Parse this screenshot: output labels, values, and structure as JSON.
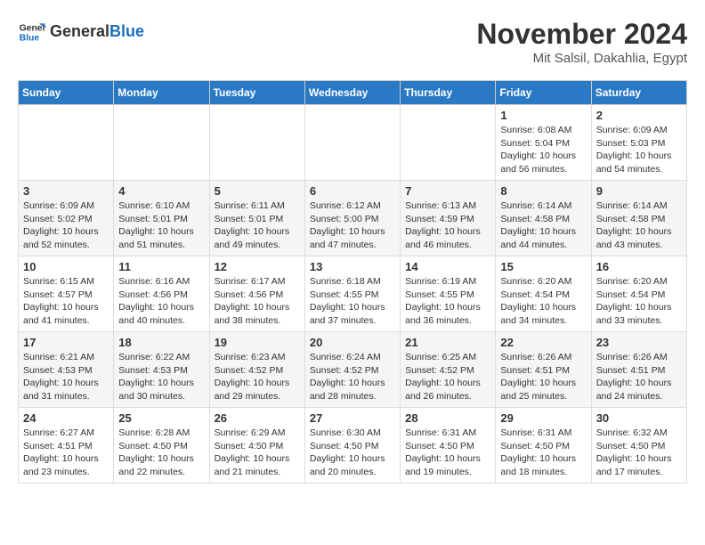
{
  "header": {
    "logo_general": "General",
    "logo_blue": "Blue",
    "month_title": "November 2024",
    "location": "Mit Salsil, Dakahlia, Egypt"
  },
  "weekdays": [
    "Sunday",
    "Monday",
    "Tuesday",
    "Wednesday",
    "Thursday",
    "Friday",
    "Saturday"
  ],
  "weeks": [
    [
      {
        "day": "",
        "info": ""
      },
      {
        "day": "",
        "info": ""
      },
      {
        "day": "",
        "info": ""
      },
      {
        "day": "",
        "info": ""
      },
      {
        "day": "",
        "info": ""
      },
      {
        "day": "1",
        "info": "Sunrise: 6:08 AM\nSunset: 5:04 PM\nDaylight: 10 hours\nand 56 minutes."
      },
      {
        "day": "2",
        "info": "Sunrise: 6:09 AM\nSunset: 5:03 PM\nDaylight: 10 hours\nand 54 minutes."
      }
    ],
    [
      {
        "day": "3",
        "info": "Sunrise: 6:09 AM\nSunset: 5:02 PM\nDaylight: 10 hours\nand 52 minutes."
      },
      {
        "day": "4",
        "info": "Sunrise: 6:10 AM\nSunset: 5:01 PM\nDaylight: 10 hours\nand 51 minutes."
      },
      {
        "day": "5",
        "info": "Sunrise: 6:11 AM\nSunset: 5:01 PM\nDaylight: 10 hours\nand 49 minutes."
      },
      {
        "day": "6",
        "info": "Sunrise: 6:12 AM\nSunset: 5:00 PM\nDaylight: 10 hours\nand 47 minutes."
      },
      {
        "day": "7",
        "info": "Sunrise: 6:13 AM\nSunset: 4:59 PM\nDaylight: 10 hours\nand 46 minutes."
      },
      {
        "day": "8",
        "info": "Sunrise: 6:14 AM\nSunset: 4:58 PM\nDaylight: 10 hours\nand 44 minutes."
      },
      {
        "day": "9",
        "info": "Sunrise: 6:14 AM\nSunset: 4:58 PM\nDaylight: 10 hours\nand 43 minutes."
      }
    ],
    [
      {
        "day": "10",
        "info": "Sunrise: 6:15 AM\nSunset: 4:57 PM\nDaylight: 10 hours\nand 41 minutes."
      },
      {
        "day": "11",
        "info": "Sunrise: 6:16 AM\nSunset: 4:56 PM\nDaylight: 10 hours\nand 40 minutes."
      },
      {
        "day": "12",
        "info": "Sunrise: 6:17 AM\nSunset: 4:56 PM\nDaylight: 10 hours\nand 38 minutes."
      },
      {
        "day": "13",
        "info": "Sunrise: 6:18 AM\nSunset: 4:55 PM\nDaylight: 10 hours\nand 37 minutes."
      },
      {
        "day": "14",
        "info": "Sunrise: 6:19 AM\nSunset: 4:55 PM\nDaylight: 10 hours\nand 36 minutes."
      },
      {
        "day": "15",
        "info": "Sunrise: 6:20 AM\nSunset: 4:54 PM\nDaylight: 10 hours\nand 34 minutes."
      },
      {
        "day": "16",
        "info": "Sunrise: 6:20 AM\nSunset: 4:54 PM\nDaylight: 10 hours\nand 33 minutes."
      }
    ],
    [
      {
        "day": "17",
        "info": "Sunrise: 6:21 AM\nSunset: 4:53 PM\nDaylight: 10 hours\nand 31 minutes."
      },
      {
        "day": "18",
        "info": "Sunrise: 6:22 AM\nSunset: 4:53 PM\nDaylight: 10 hours\nand 30 minutes."
      },
      {
        "day": "19",
        "info": "Sunrise: 6:23 AM\nSunset: 4:52 PM\nDaylight: 10 hours\nand 29 minutes."
      },
      {
        "day": "20",
        "info": "Sunrise: 6:24 AM\nSunset: 4:52 PM\nDaylight: 10 hours\nand 28 minutes."
      },
      {
        "day": "21",
        "info": "Sunrise: 6:25 AM\nSunset: 4:52 PM\nDaylight: 10 hours\nand 26 minutes."
      },
      {
        "day": "22",
        "info": "Sunrise: 6:26 AM\nSunset: 4:51 PM\nDaylight: 10 hours\nand 25 minutes."
      },
      {
        "day": "23",
        "info": "Sunrise: 6:26 AM\nSunset: 4:51 PM\nDaylight: 10 hours\nand 24 minutes."
      }
    ],
    [
      {
        "day": "24",
        "info": "Sunrise: 6:27 AM\nSunset: 4:51 PM\nDaylight: 10 hours\nand 23 minutes."
      },
      {
        "day": "25",
        "info": "Sunrise: 6:28 AM\nSunset: 4:50 PM\nDaylight: 10 hours\nand 22 minutes."
      },
      {
        "day": "26",
        "info": "Sunrise: 6:29 AM\nSunset: 4:50 PM\nDaylight: 10 hours\nand 21 minutes."
      },
      {
        "day": "27",
        "info": "Sunrise: 6:30 AM\nSunset: 4:50 PM\nDaylight: 10 hours\nand 20 minutes."
      },
      {
        "day": "28",
        "info": "Sunrise: 6:31 AM\nSunset: 4:50 PM\nDaylight: 10 hours\nand 19 minutes."
      },
      {
        "day": "29",
        "info": "Sunrise: 6:31 AM\nSunset: 4:50 PM\nDaylight: 10 hours\nand 18 minutes."
      },
      {
        "day": "30",
        "info": "Sunrise: 6:32 AM\nSunset: 4:50 PM\nDaylight: 10 hours\nand 17 minutes."
      }
    ]
  ]
}
